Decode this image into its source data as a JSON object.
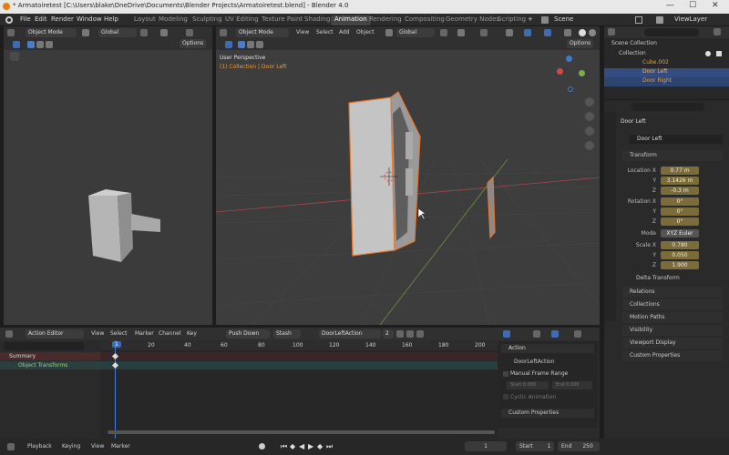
{
  "window": {
    "title": "* Armatoiretest [C:\\Users\\blake\\OneDrive\\Documents\\Blender Projects\\Armatoiretest.blend] - Blender 4.0"
  },
  "menu": [
    "File",
    "Edit",
    "Render",
    "Window",
    "Help"
  ],
  "workspaces": [
    "Layout",
    "Modeling",
    "Sculpting",
    "UV Editing",
    "Texture Paint",
    "Shading",
    "Animation",
    "Rendering",
    "Compositing",
    "Geometry Nodes",
    "Scripting"
  ],
  "active_workspace": "Animation",
  "scene_name": "Scene",
  "viewlayer_name": "ViewLayer",
  "left_view": {
    "mode": "Object Mode",
    "orientation": "Global",
    "options": "Options"
  },
  "main_view": {
    "mode": "Object Mode",
    "menus": [
      "View",
      "Select",
      "Add",
      "Object"
    ],
    "orientation": "Global",
    "options": "Options",
    "overlay_title": "User Perspective",
    "overlay_subtitle": "(1) Collection | Door Left"
  },
  "outliner": {
    "root": "Scene Collection",
    "collection": "Collection",
    "items": [
      "Cube.002",
      "Door Left",
      "Door Right"
    ]
  },
  "properties": {
    "object_name": "Door Left",
    "data_name": "Door Left",
    "transform_label": "Transform",
    "location_x_label": "Location X",
    "location_x": "0.77 m",
    "location_y": "3.1426 m",
    "location_z": "-0.3 m",
    "rotation_x_label": "Rotation X",
    "rotation_x": "0°",
    "rotation_y": "0°",
    "rotation_z": "0°",
    "mode_label": "Mode",
    "mode_value": "XYZ Euler",
    "scale_x_label": "Scale X",
    "scale_x": "0.780",
    "scale_y": "0.050",
    "scale_z": "1.900",
    "y": "Y",
    "z": "Z",
    "delta_transform": "Delta Transform",
    "panels": [
      "Relations",
      "Collections",
      "Motion Paths",
      "Visibility",
      "Viewport Display",
      "Custom Properties"
    ]
  },
  "dopesheet": {
    "editor_mode": "Action Editor",
    "menus": [
      "View",
      "Select",
      "Marker",
      "Channel",
      "Key"
    ],
    "push_down": "Push Down",
    "stash": "Stash",
    "action_name": "DoorLeftAction",
    "users": "2",
    "frames": [
      "1",
      "20",
      "40",
      "60",
      "80",
      "100",
      "120",
      "140",
      "160",
      "180",
      "200"
    ],
    "channels": [
      "Summary",
      "Object Transforms"
    ]
  },
  "action_panel": {
    "title": "Action",
    "action_name": "DoorLeftAction",
    "manual_frame_range": "Manual Frame Range",
    "start_label": "Start",
    "start_value": "0.000",
    "end_label": "End",
    "end_value": "0.000",
    "cyclic": "Cyclic Animation",
    "custom_props": "Custom Properties"
  },
  "timeline": {
    "menus": [
      "Playback",
      "Keying",
      "View",
      "Marker"
    ],
    "current_frame": "1",
    "start_label": "Start",
    "start_value": "1",
    "end_label": "End",
    "end_value": "250"
  }
}
